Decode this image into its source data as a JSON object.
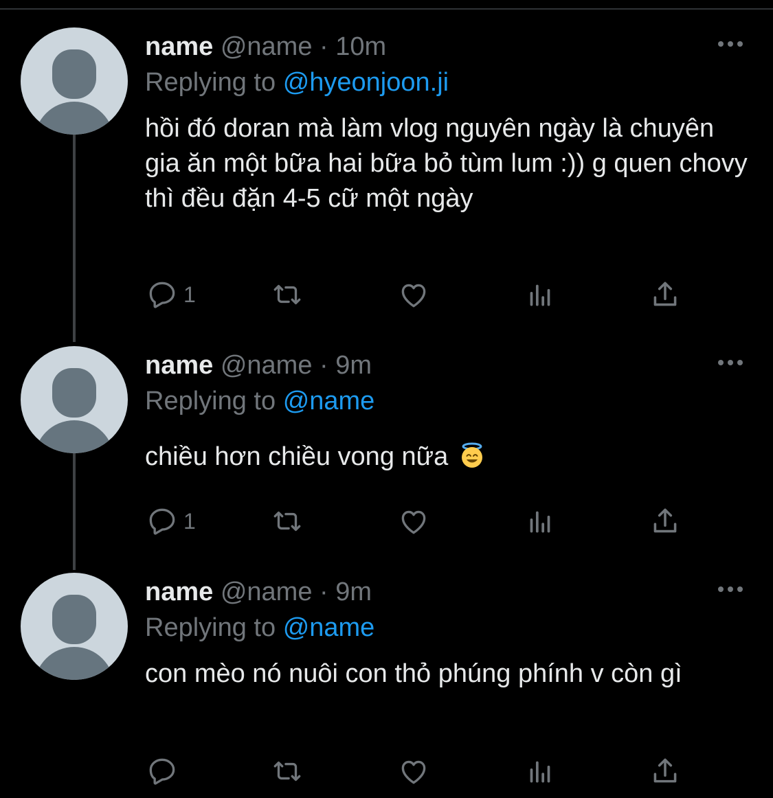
{
  "tweets": [
    {
      "display_name": "name",
      "handle": "@name",
      "separator": "·",
      "time": "10m",
      "replying_prefix": "Replying to",
      "reply_to": "@hyeonjoon.ji",
      "text": "hồi đó doran mà làm vlog nguyên ngày là chuyên gia ăn một bữa hai bữa bỏ tùm lum :)) g quen chovy thì đều đặn 4-5 cữ một ngày",
      "reply_count": "1"
    },
    {
      "display_name": "name",
      "handle": "@name",
      "separator": "·",
      "time": "9m",
      "replying_prefix": "Replying to",
      "reply_to": "@name",
      "text": "chiều hơn chiều vong nữa",
      "emoji": "smiling-face-with-halo",
      "reply_count": "1"
    },
    {
      "display_name": "name",
      "handle": "@name",
      "separator": "·",
      "time": "9m",
      "replying_prefix": "Replying to",
      "reply_to": "@name",
      "text": "con mèo nó nuôi con thỏ phúng phính v còn gì",
      "reply_count": ""
    }
  ],
  "icons": [
    "reply-icon",
    "retweet-icon",
    "like-icon",
    "views-icon",
    "share-icon",
    "more-icon",
    "default-avatar-icon"
  ],
  "colors": {
    "background": "#000000",
    "text": "#e7e9ea",
    "muted": "#71767b",
    "link": "#1d9bf0",
    "thread_line": "#3e4144",
    "avatar_bg": "#ccd6dd",
    "avatar_fg": "#66757f"
  }
}
